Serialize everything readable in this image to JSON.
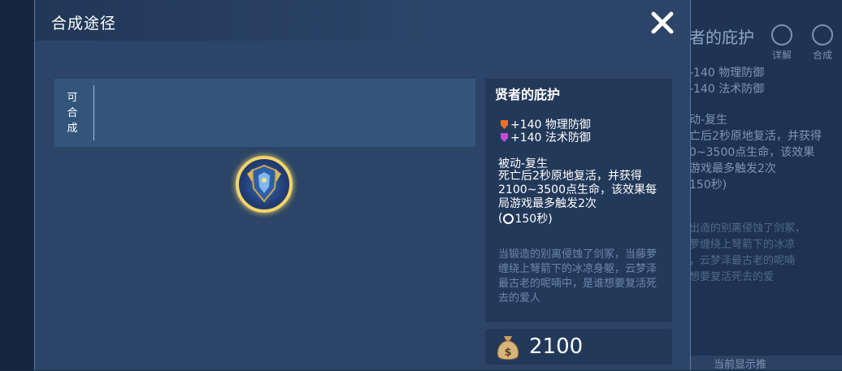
{
  "background": {
    "title_fragment": "者的庇护",
    "tools": [
      {
        "label": "详解",
        "icon": "play-circle-icon"
      },
      {
        "label": "合成",
        "icon": "crossed-swords-icon"
      }
    ],
    "stat_lines": "-140 物理防御\n-140 法术防御",
    "passive_lines": "动-复生\n亡后2秒原地复活，并获得\n0~3500点生命，该效果\n游戏最多触发2次\n150秒)",
    "lore_lines": "出造的别离侵蚀了剑冢，\n萝缠绕上弩箭下的冰凉\n，云梦泽最古老的呢喃\n想要复活死去的爱",
    "bottom_fragment": "当前显示推"
  },
  "dialog": {
    "title": "合成途径",
    "close_icon": "close-icon",
    "craft_label": "可合成"
  },
  "item": {
    "name": "贤者的庇护",
    "stats": [
      {
        "text": "+140 物理防御",
        "color": "#e8702a"
      },
      {
        "text": "+140 法术防御",
        "color": "#c24bd6"
      }
    ],
    "passive_title": "被动-复生",
    "passive_desc": "死亡后2秒原地复活，并获得2100~3500点生命，该效果每局游戏最多触发2次",
    "cooldown_prefix": "(",
    "cooldown_value": "150秒)",
    "lore": "当锻造的别离侵蚀了剑冢，当藤萝缠绕上弩箭下的冰凉身躯，云梦泽最古老的呢喃中，是谁想要复活死去的爱人",
    "price": "2100"
  },
  "colors": {
    "frame_gold": "#f2d46a",
    "panel_bg": "#23395a",
    "dialog_bg": "#2b4467"
  }
}
